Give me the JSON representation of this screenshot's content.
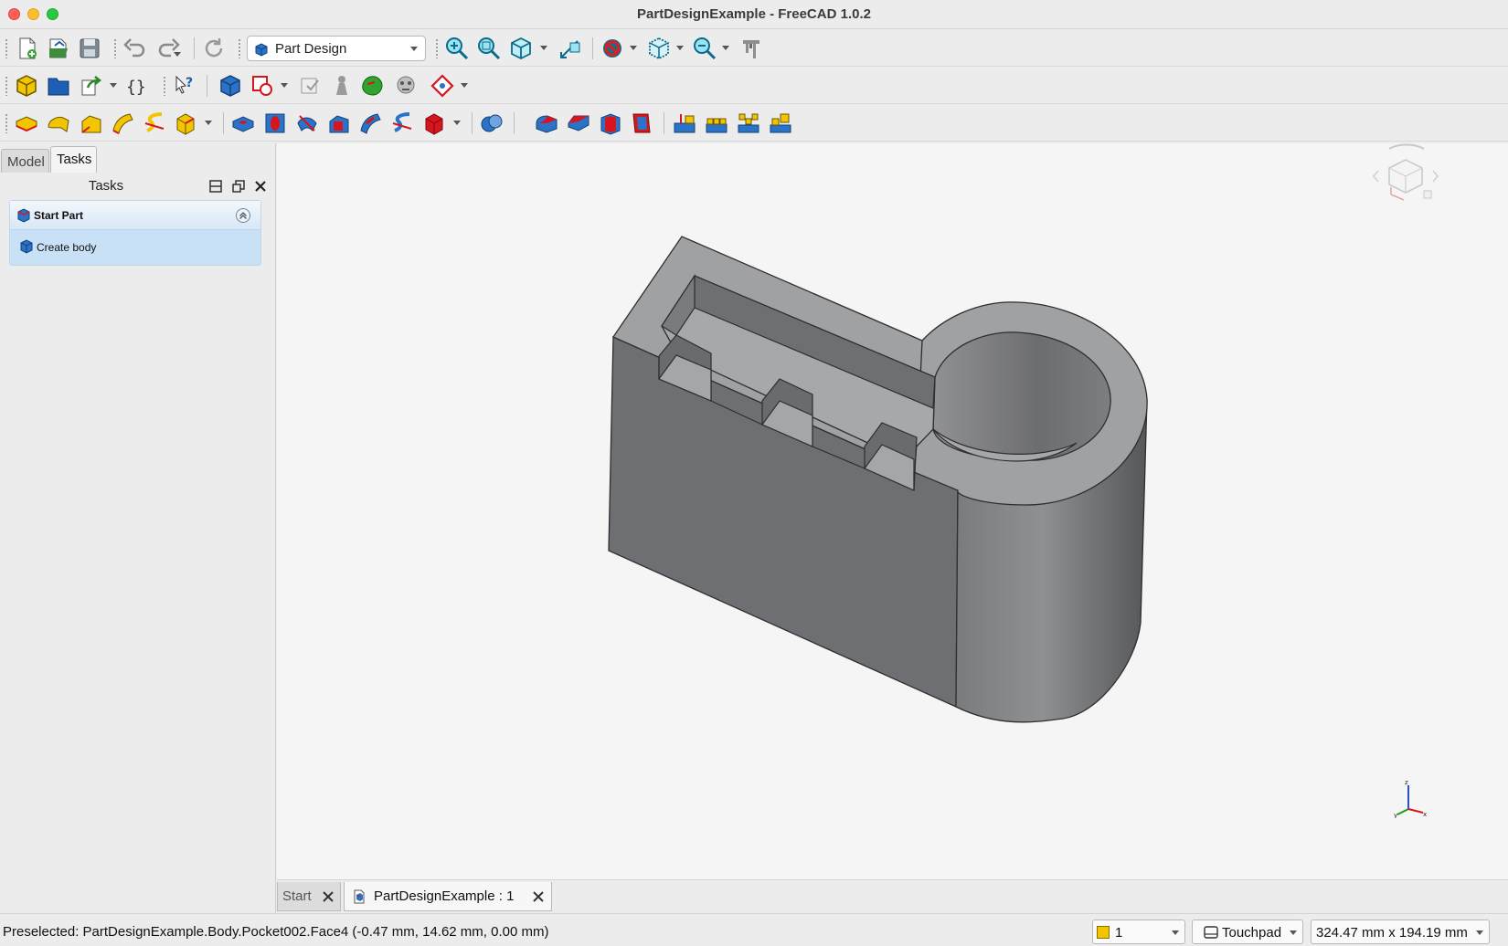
{
  "window": {
    "title": "PartDesignExample - FreeCAD 1.0.2"
  },
  "toolbar": {
    "workbench_label": "Part Design"
  },
  "panel": {
    "tabs": [
      "Model",
      "Tasks"
    ],
    "active_tab": "Tasks",
    "title": "Tasks",
    "task_group": {
      "title": "Start Part",
      "items": [
        "Create body"
      ]
    }
  },
  "doc_tabs": [
    {
      "label": "Start"
    },
    {
      "label": "PartDesignExample : 1",
      "active": true
    }
  ],
  "status": {
    "preselected": "Preselected: PartDesignExample.Body.Pocket002.Face4 (-0.47 mm, 14.62 mm, 0.00 mm)",
    "layer_value": "1",
    "navigation_style": "Touchpad",
    "dimensions": "324.47 mm x 194.19 mm"
  },
  "colors": {
    "accent_yellow": "#f2c500",
    "accent_red": "#d8141c",
    "accent_blue": "#2a73c6",
    "task_panel_blue": "#c8e1f7",
    "model_grey": "#8a8b8d"
  }
}
